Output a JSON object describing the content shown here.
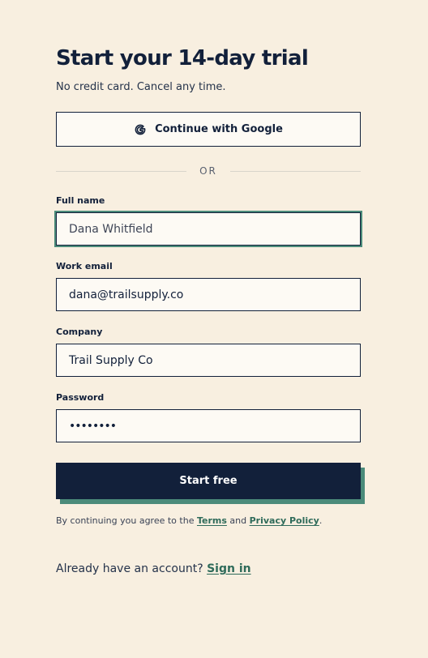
{
  "header": {
    "title": "Start your 14-day trial",
    "subtitle": "No credit card. Cancel any time."
  },
  "google": {
    "label": "Continue with Google",
    "icon": "google-g-icon"
  },
  "divider": {
    "label": "OR"
  },
  "form": {
    "full_name": {
      "label": "Full name",
      "value": "Dana Whitfield"
    },
    "work_email": {
      "label": "Work email",
      "value": "dana@trailsupply.co"
    },
    "company": {
      "label": "Company",
      "value": "Trail Supply Co"
    },
    "password": {
      "label": "Password",
      "value": "••••••••"
    }
  },
  "cta": {
    "label": "Start free"
  },
  "legal": {
    "prefix": "By continuing you agree to the ",
    "terms": "Terms",
    "middle": " and ",
    "privacy": "Privacy Policy",
    "suffix": "."
  },
  "signin": {
    "prompt": "Already have an account? ",
    "link": "Sign in"
  },
  "colors": {
    "background": "#f8efe0",
    "primary": "#12203a",
    "accent": "#4b8b7a",
    "link": "#2f6b5a"
  }
}
